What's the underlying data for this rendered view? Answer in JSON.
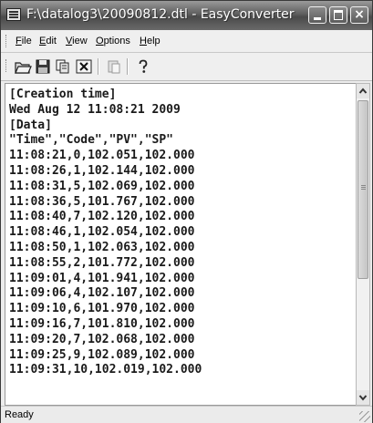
{
  "window": {
    "title": "F:\\datalog3\\20090812.dtl - EasyConverter",
    "controls": {
      "minimize": "minimize",
      "maximize": "maximize",
      "close": "×"
    }
  },
  "menu": {
    "items": [
      {
        "label": "File",
        "mnemonic": "F",
        "rest": "ile"
      },
      {
        "label": "Edit",
        "mnemonic": "E",
        "rest": "dit"
      },
      {
        "label": "View",
        "mnemonic": "V",
        "rest": "iew"
      },
      {
        "label": "Options",
        "mnemonic": "O",
        "rest": "ptions"
      },
      {
        "label": "Help",
        "mnemonic": "H",
        "rest": "elp"
      }
    ]
  },
  "toolbar": {
    "icons": [
      "open-folder-icon",
      "save-icon",
      "copy-icon",
      "excel-export-icon",
      "paste-icon",
      "help-icon"
    ]
  },
  "content": {
    "lines": [
      "[Creation time]",
      "Wed Aug 12 11:08:21 2009",
      "[Data]",
      "\"Time\",\"Code\",\"PV\",\"SP\"",
      "11:08:21,0,102.051,102.000",
      "11:08:26,1,102.144,102.000",
      "11:08:31,5,102.069,102.000",
      "11:08:36,5,101.767,102.000",
      "11:08:40,7,102.120,102.000",
      "11:08:46,1,102.054,102.000",
      "11:08:50,1,102.063,102.000",
      "11:08:55,2,101.772,102.000",
      "11:09:01,4,101.941,102.000",
      "11:09:06,4,102.107,102.000",
      "11:09:10,6,101.970,102.000",
      "11:09:16,7,101.810,102.000",
      "11:09:20,7,102.068,102.000",
      "11:09:25,9,102.089,102.000",
      "11:09:31,10,102.019,102.000"
    ]
  },
  "status": {
    "text": "Ready"
  },
  "colors": {
    "titlebar": "#5e5e5e",
    "text": "#1a1a1a",
    "background": "#ffffff"
  }
}
